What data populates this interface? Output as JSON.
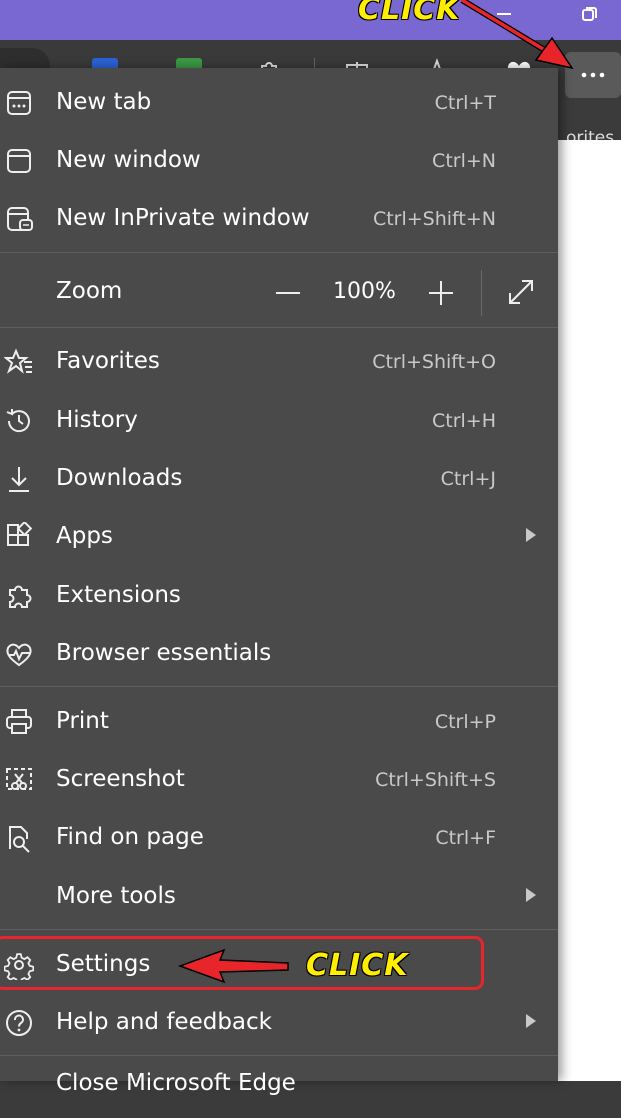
{
  "toolbar": {
    "page_text_partial": "orites"
  },
  "menu": {
    "items": [
      {
        "label": "New tab",
        "shortcut": "Ctrl+T"
      },
      {
        "label": "New window",
        "shortcut": "Ctrl+N"
      },
      {
        "label": "New InPrivate window",
        "shortcut": "Ctrl+Shift+N"
      },
      {
        "label": "Favorites",
        "shortcut": "Ctrl+Shift+O"
      },
      {
        "label": "History",
        "shortcut": "Ctrl+H"
      },
      {
        "label": "Downloads",
        "shortcut": "Ctrl+J"
      },
      {
        "label": "Apps",
        "shortcut": ""
      },
      {
        "label": "Extensions",
        "shortcut": ""
      },
      {
        "label": "Browser essentials",
        "shortcut": ""
      },
      {
        "label": "Print",
        "shortcut": "Ctrl+P"
      },
      {
        "label": "Screenshot",
        "shortcut": "Ctrl+Shift+S"
      },
      {
        "label": "Find on page",
        "shortcut": "Ctrl+F"
      },
      {
        "label": "More tools",
        "shortcut": ""
      },
      {
        "label": "Settings",
        "shortcut": ""
      },
      {
        "label": "Help and feedback",
        "shortcut": ""
      },
      {
        "label": "Close Microsoft Edge",
        "shortcut": ""
      }
    ],
    "zoom": {
      "label": "Zoom",
      "value": "100%"
    }
  },
  "annotations": {
    "click_top": "CLICK",
    "click_settings": "CLICK"
  },
  "colors": {
    "titlebar": "#7a68d2",
    "menu_bg": "#4a4a4a",
    "highlight_red": "#e8252b",
    "annotation_yellow": "#ffee00"
  },
  "icons": [
    "new-tab-icon",
    "new-window-icon",
    "inprivate-icon",
    "favorites-icon",
    "history-icon",
    "downloads-icon",
    "apps-icon",
    "extensions-icon",
    "browser-essentials-icon",
    "print-icon",
    "screenshot-icon",
    "find-on-page-icon",
    "settings-icon",
    "help-icon",
    "more-dots-icon",
    "fullscreen-icon"
  ]
}
